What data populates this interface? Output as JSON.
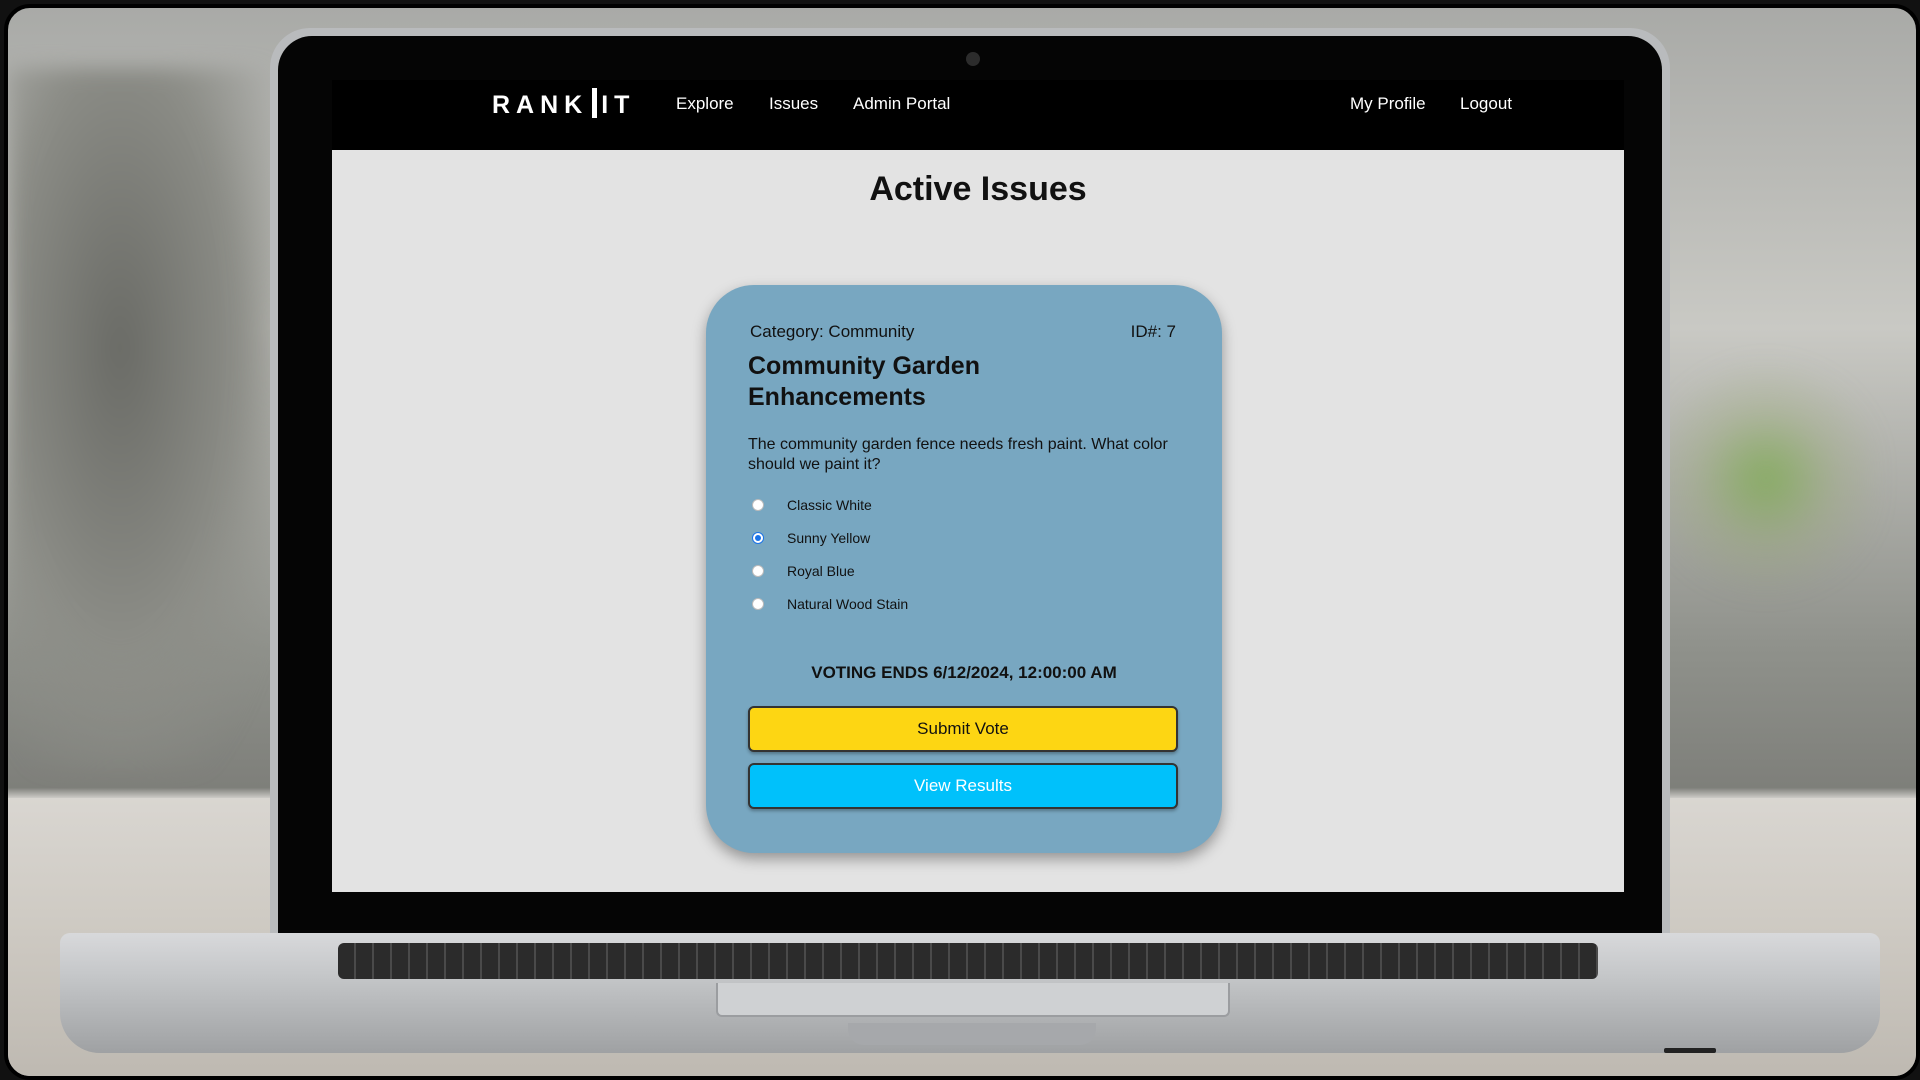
{
  "navbar": {
    "logo_text_left": "RANK",
    "logo_text_right": "IT",
    "links": [
      "Explore",
      "Issues",
      "Admin Portal"
    ],
    "right_links": [
      "My Profile",
      "Logout"
    ]
  },
  "page": {
    "title": "Active Issues"
  },
  "card": {
    "category": "Category: Community",
    "id": "ID#: 7",
    "title": "Community Garden Enhancements",
    "question": "The community garden fence needs fresh paint. What color should we paint it?",
    "options": [
      "Classic White",
      "Sunny Yellow",
      "Royal Blue",
      "Natural Wood Stain"
    ],
    "selected_option": "Sunny Yellow",
    "voting_ends": "VOTING ENDS 6/12/2024, 12:00:00 AM",
    "submit_label": "Submit Vote",
    "results_label": "View Results"
  },
  "colors": {
    "card_bg": "#78a7c1",
    "submit_bg": "#fdd613",
    "results_bg": "#00c1fb",
    "page_bg": "#e3e3e3",
    "navbar_bg": "#000000"
  }
}
